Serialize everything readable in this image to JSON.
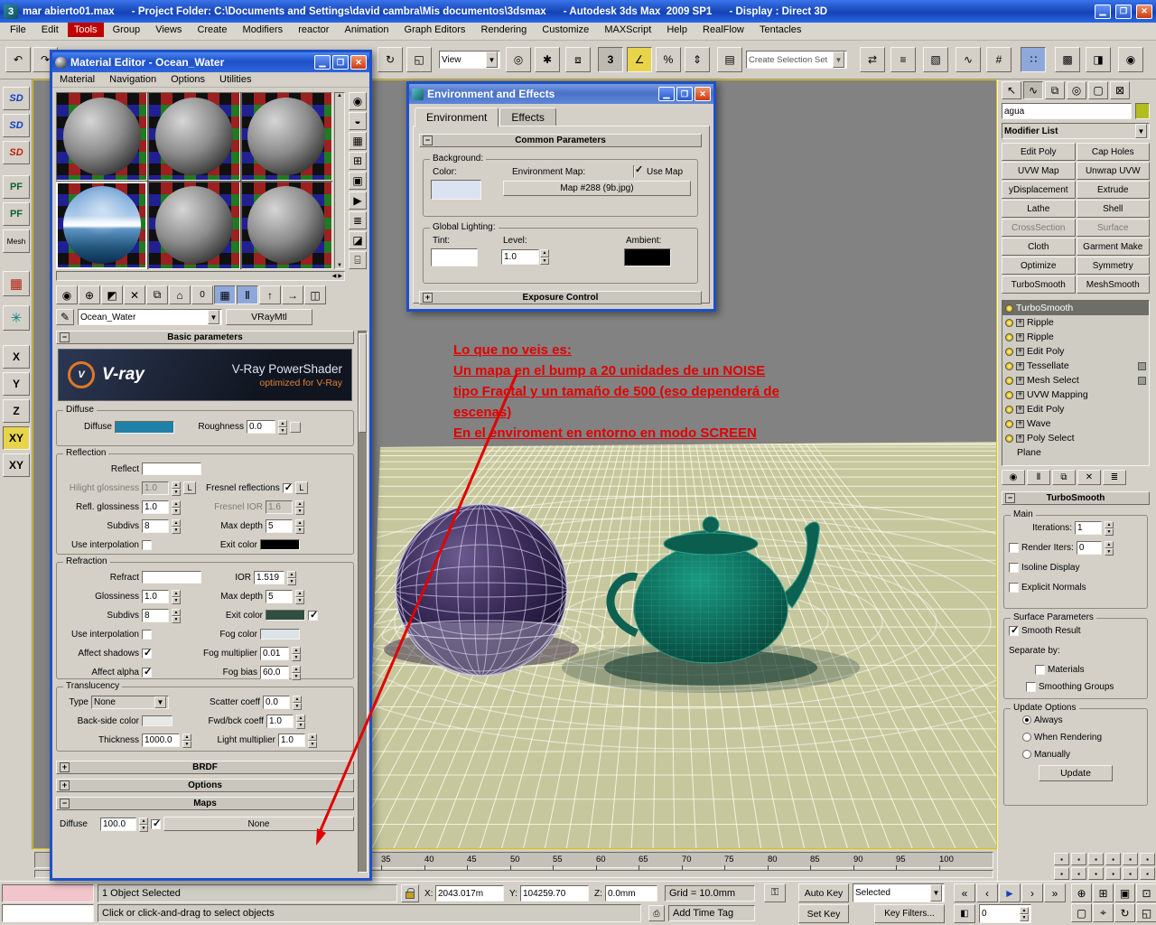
{
  "titlebar": {
    "title": "mar abierto01.max      - Project Folder: C:\\Documents and Settings\\david cambra\\Mis documentos\\3dsmax      - Autodesk 3ds Max  2009 SP1      - Display : Direct 3D"
  },
  "menubar": {
    "items": [
      "File",
      "Edit",
      "Tools",
      "Group",
      "Views",
      "Create",
      "Modifiers",
      "reactor",
      "Animation",
      "Graph Editors",
      "Rendering",
      "Customize",
      "MAXScript",
      "Help",
      "RealFlow",
      "Tentacles"
    ]
  },
  "toolbar": {
    "coord_system": "View",
    "selection_set": "Create Selection Set"
  },
  "left_toolbar": {
    "labels": [
      "SD",
      "SD",
      "SD",
      "PF",
      "PF",
      "Mesh"
    ],
    "axes": [
      "X",
      "Y",
      "Z",
      "XY",
      "XY"
    ]
  },
  "material_editor": {
    "title": "Material Editor - Ocean_Water",
    "menu": [
      "Material",
      "Navigation",
      "Options",
      "Utilities"
    ],
    "material_name": "Ocean_Water",
    "material_type": "VRayMtl",
    "basic_rollout": "Basic parameters",
    "banner": {
      "brand": "V-ray",
      "title": "V-Ray PowerShader",
      "subtitle": "optimized for V-Ray"
    },
    "diffuse": {
      "group": "Diffuse",
      "diffuse_label": "Diffuse",
      "roughness_label": "Roughness",
      "roughness": "0.0",
      "color": "#2080a8"
    },
    "reflection": {
      "group": "Reflection",
      "reflect_label": "Reflect",
      "hilight_label": "Hilight glossiness",
      "hilight": "1.0",
      "l": "L",
      "fresnel_label": "Fresnel reflections",
      "refl_gloss_label": "Refl. glossiness",
      "refl_gloss": "1.0",
      "fresnel_ior_label": "Fresnel IOR",
      "fresnel_ior": "1.6",
      "subdivs_label": "Subdivs",
      "subdivs": "8",
      "max_depth_label": "Max depth",
      "max_depth": "5",
      "use_interp_label": "Use interpolation",
      "exit_color_label": "Exit color"
    },
    "refraction": {
      "group": "Refraction",
      "refract_label": "Refract",
      "ior_label": "IOR",
      "ior": "1.519",
      "glossiness_label": "Glossiness",
      "glossiness": "1.0",
      "max_depth_label": "Max depth",
      "max_depth": "5",
      "subdivs_label": "Subdivs",
      "subdivs": "8",
      "exit_color_label": "Exit color",
      "exit_color": "#2e4f41",
      "use_interp_label": "Use interpolation",
      "fog_color_label": "Fog color",
      "affect_shadows_label": "Affect shadows",
      "fog_mult_label": "Fog multiplier",
      "fog_mult": "0.01",
      "affect_alpha_label": "Affect alpha",
      "fog_bias_label": "Fog bias",
      "fog_bias": "60.0"
    },
    "translucency": {
      "group": "Translucency",
      "type_label": "Type",
      "type": "None",
      "scatter_label": "Scatter coeff",
      "scatter": "0.0",
      "back_label": "Back-side color",
      "fwd_label": "Fwd/bck coeff",
      "fwd": "1.0",
      "thickness_label": "Thickness",
      "thickness": "1000.0",
      "light_mult_label": "Light multiplier",
      "light_mult": "1.0"
    },
    "brdf_rollout": "BRDF",
    "options_rollout": "Options",
    "maps_rollout": "Maps",
    "maps_row": {
      "label": "Diffuse",
      "amount": "100.0",
      "map_button": "None"
    }
  },
  "environment": {
    "title": "Environment and Effects",
    "tabs": [
      "Environment",
      "Effects"
    ],
    "common_rollout": "Common Parameters",
    "background_group": "Background:",
    "color_label": "Color:",
    "env_map_label": "Environment Map:",
    "use_map": "Use Map",
    "map_button": "Map #288 (9b.jpg)",
    "global_group": "Global Lighting:",
    "tint_label": "Tint:",
    "level_label": "Level:",
    "level": "1.0",
    "ambient_label": "Ambient:",
    "next_rollout": "Exposure Control"
  },
  "annotation": {
    "lines": [
      "Lo que no veis es:",
      "Un mapa en el bump a 20 unidades de un NOISE",
      "tipo Fractal y un tamaño de 500 (eso dependerá de",
      "escenas)",
      "En el enviroment en entorno en modo SCREEN"
    ]
  },
  "command_panel": {
    "object_name": "agua",
    "modifier_list": "Modifier List",
    "buttons": [
      "Edit Poly",
      "Cap Holes",
      "UVW Map",
      "Unwrap UVW",
      "yDisplacement",
      "Extrude",
      "Lathe",
      "Shell",
      "CrossSection",
      "Surface",
      "Cloth",
      "Garment Make",
      "Optimize",
      "Symmetry",
      "TurboSmooth",
      "MeshSmooth"
    ],
    "stack": [
      "TurboSmooth",
      "Ripple",
      "Ripple",
      "Edit Poly",
      "Tessellate",
      "Mesh Select",
      "UVW Mapping",
      "Edit Poly",
      "Wave",
      "Poly Select",
      "Plane"
    ],
    "turbosmooth": {
      "rollout": "TurboSmooth",
      "main_group": "Main",
      "iterations_label": "Iterations:",
      "iterations": "1",
      "render_iters_label": "Render Iters:",
      "render_iters": "0",
      "isoline": "Isoline Display",
      "explicit": "Explicit Normals",
      "surface_group": "Surface Parameters",
      "smooth_result": "Smooth Result",
      "separate_by": "Separate by:",
      "materials": "Materials",
      "smoothing_groups": "Smoothing Groups",
      "update_group": "Update Options",
      "always": "Always",
      "when_rendering": "When Rendering",
      "manually": "Manually",
      "update_button": "Update"
    }
  },
  "timeline": {
    "ticks": [
      "35",
      "40",
      "45",
      "50",
      "55",
      "60",
      "65",
      "70",
      "75",
      "80",
      "85",
      "90",
      "95",
      "100"
    ]
  },
  "status_bar": {
    "selection": "1 Object Selected",
    "prompt": "Click or click-and-drag to select objects",
    "x_label": "X:",
    "x": "2043.017m",
    "y_label": "Y:",
    "y": "104259.70",
    "z_label": "Z:",
    "z": "0.0mm",
    "grid": "Grid = 10.0mm",
    "add_time_tag": "Add Time Tag",
    "auto_key": "Auto Key",
    "set_key": "Set Key",
    "key_mode": "Selected",
    "key_filters": "Key Filters...",
    "frame": "0"
  }
}
